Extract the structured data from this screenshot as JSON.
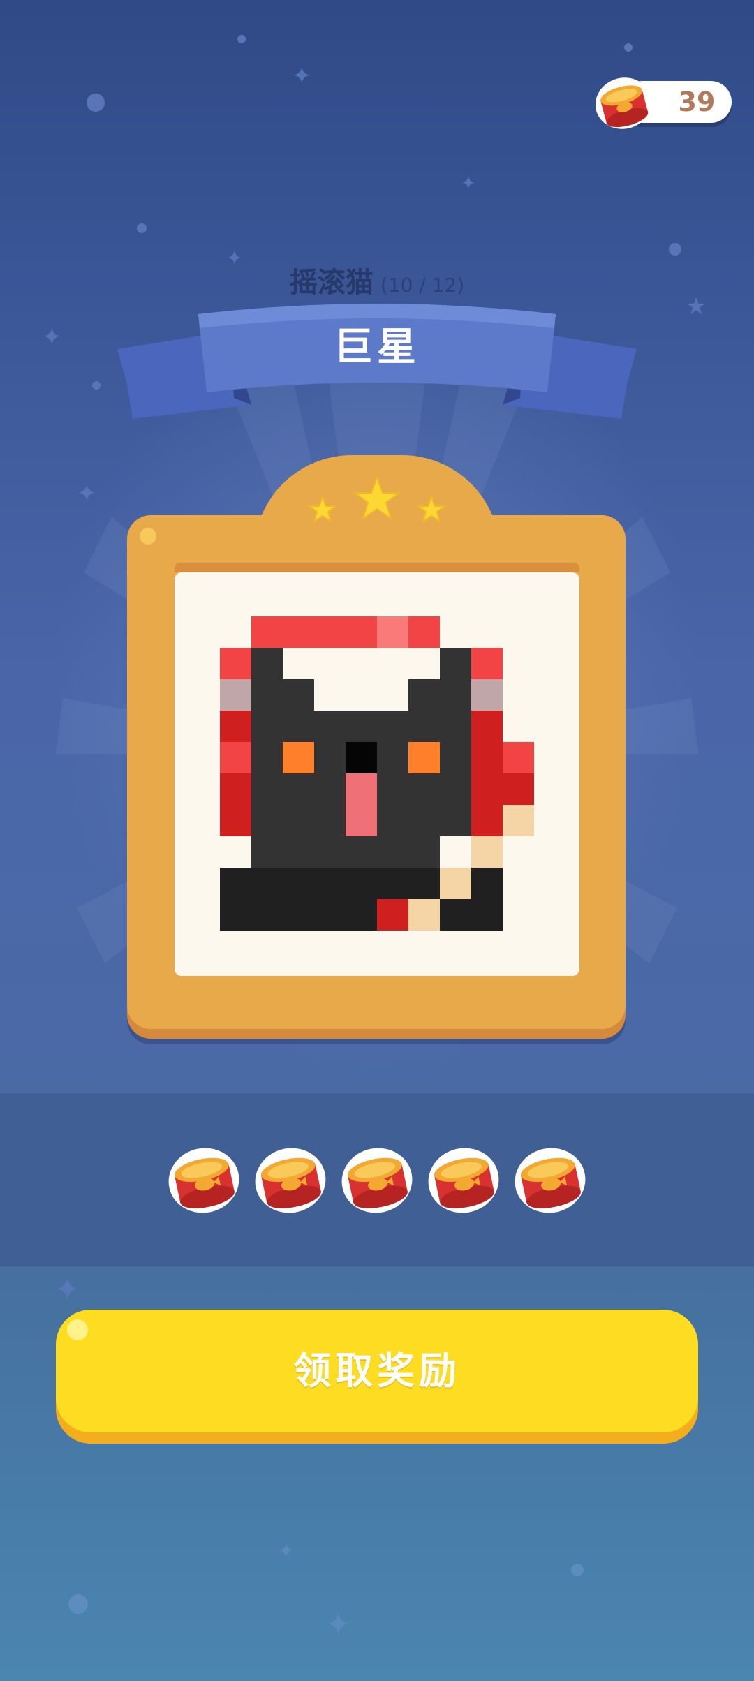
{
  "coins": {
    "value": "39",
    "icon": "cat-food-can-icon"
  },
  "header": {
    "cat_name": "摇滚猫",
    "progress": "(10 / 12)"
  },
  "ribbon": {
    "rank": "巨星"
  },
  "frame": {
    "stars": 3,
    "star_color": "#fcd832",
    "frame_color": "#e8a94b"
  },
  "rewards": {
    "count": 5,
    "icon": "cat-food-can-icon"
  },
  "button": {
    "label": "领取奖励",
    "color": "#fedc22"
  }
}
